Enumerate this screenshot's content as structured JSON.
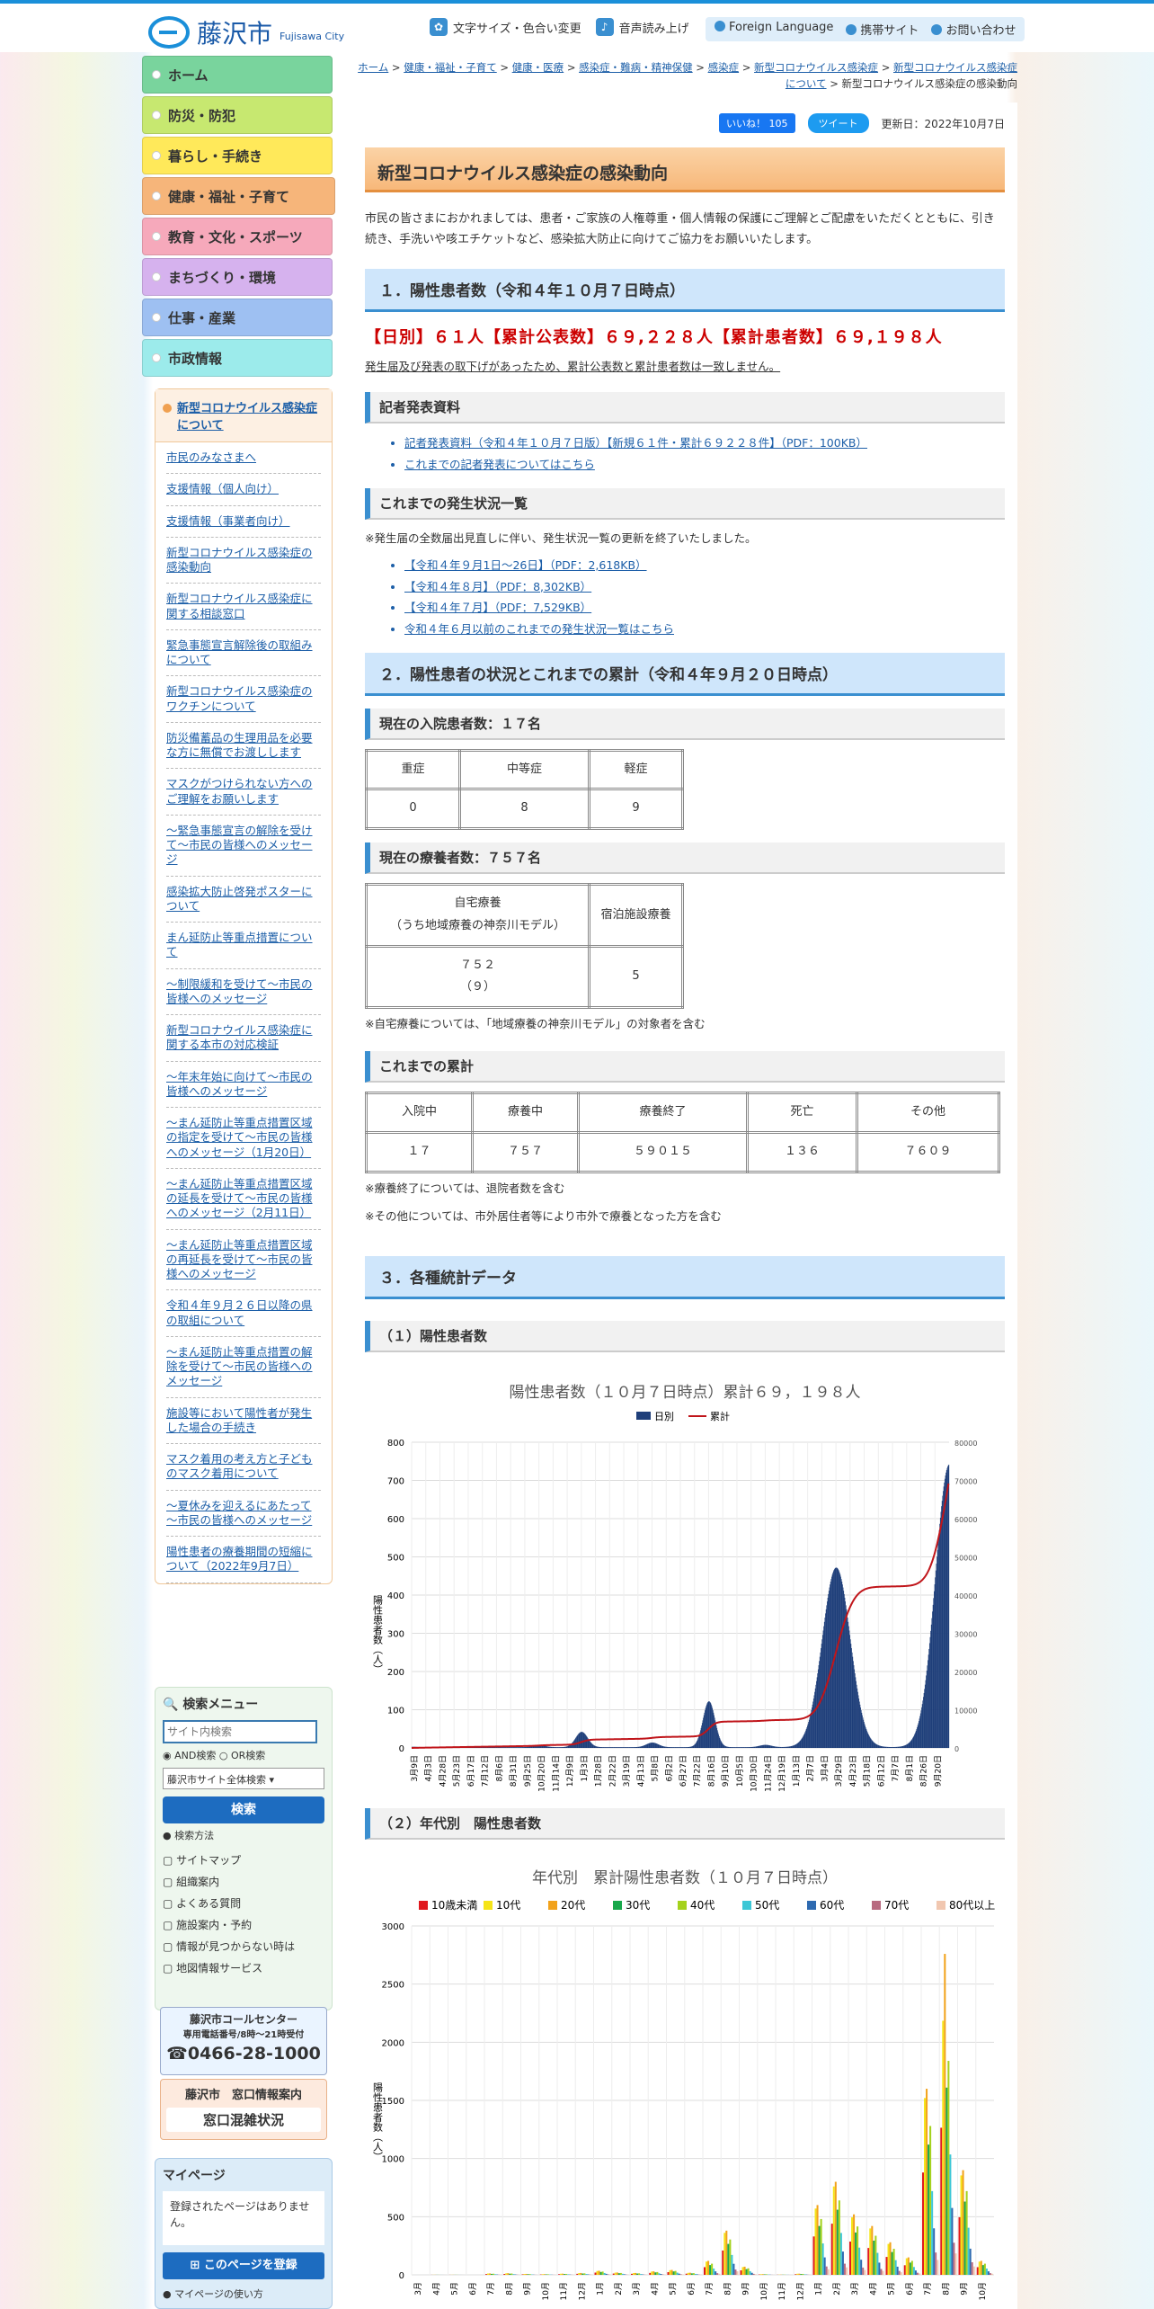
{
  "header": {
    "logo": "藤沢市",
    "logo_en": "Fujisawa City",
    "tools": [
      "文字サイズ・色合い変更",
      "音声読み上げ"
    ],
    "links": [
      "Foreign Language",
      "携帯サイト",
      "お問い合わせ"
    ]
  },
  "gnav": [
    {
      "label": "ホーム",
      "color": "#79d49d"
    },
    {
      "label": "防災・防犯",
      "color": "#c7e870"
    },
    {
      "label": "暮らし・手続き",
      "color": "#ffe95a"
    },
    {
      "label": "健康・福祉・子育て",
      "color": "#f6ac6a"
    },
    {
      "label": "教育・文化・スポーツ",
      "color": "#f6a9bb"
    },
    {
      "label": "まちづくり・環境",
      "color": "#d6b2ee"
    },
    {
      "label": "仕事・産業",
      "color": "#9ec0f2"
    },
    {
      "label": "市政情報",
      "color": "#9cebeb"
    }
  ],
  "side": {
    "head": "新型コロナウイルス感染症について",
    "items": [
      "市民のみなさまへ",
      "支援情報（個人向け）",
      "支援情報（事業者向け）",
      "新型コロナウイルス感染症の感染動向",
      "新型コロナウイルス感染症に関する相談窓口",
      "緊急事態宣言解除後の取組みについて",
      "新型コロナウイルス感染症のワクチンについて",
      "防災備蓄品の生理用品を必要な方に無償でお渡しします",
      "マスクがつけられない方へのご理解をお願いします",
      "～緊急事態宣言の解除を受けて～市民の皆様へのメッセージ",
      "感染拡大防止啓発ポスターについて",
      "まん延防止等重点措置について",
      "～制限緩和を受けて～市民の皆様へのメッセージ",
      "新型コロナウイルス感染症に関する本市の対応検証",
      "～年末年始に向けて～市民の皆様へのメッセージ",
      "～まん延防止等重点措置区域の指定を受けて～市民の皆様へのメッセージ（1月20日）",
      "～まん延防止等重点措置区域の延長を受けて～市民の皆様へのメッセージ（2月11日）",
      "～まん延防止等重点措置区域の再延長を受けて～市民の皆様へのメッセージ",
      "令和４年９月２６日以降の県の取組について",
      "～まん延防止等重点措置の解除を受けて～市民の皆様へのメッセージ",
      "施設等において陽性者が発生した場合の手続き",
      "マスク着用の考え方と子どものマスク着用について",
      "～夏休みを迎えるにあたって～市民の皆様へのメッセージ",
      "陽性患者の療養期間の短縮について（2022年9月7日）"
    ]
  },
  "search": {
    "title": "検索メニュー",
    "placeholder": "サイト内検索",
    "and": "AND検索",
    "or": "OR検索",
    "scope": "藤沢市サイト全体検索",
    "button": "検索",
    "how": "検索方法",
    "links": [
      "サイトマップ",
      "組織案内",
      "よくある質問",
      "施設案内・予約",
      "情報が見つからない時は",
      "地図情報サービス"
    ]
  },
  "call": {
    "l1": "藤沢市コールセンター",
    "l2": "専用電話番号/8時～21時受付",
    "tel": "0466-28-1000"
  },
  "mado": {
    "l1": "藤沢市　窓口情報案内",
    "l2": "窓口混雑状況"
  },
  "mypage": {
    "title": "マイページ",
    "text": "登録されたページはありません。",
    "btn": "このページを登録",
    "how": "マイページの使い方"
  },
  "breadcrumb": [
    "ホーム",
    "健康・福祉・子育て",
    "健康・医療",
    "感染症・難病・精神保健",
    "感染症",
    "新型コロナウイルス感染症",
    "新型コロナウイルス感染症について",
    "新型コロナウイルス感染症の感染動向"
  ],
  "meta": {
    "like": "いいね！ 105",
    "tweet": "ツイート",
    "updated": "更新日：2022年10月7日"
  },
  "title": "新型コロナウイルス感染症の感染動向",
  "intro": "市民の皆さまにおかれましては、患者・ご家族の人権尊重・個人情報の保護にご理解とご配慮をいただくとともに、引き続き、手洗いや咳エチケットなど、感染拡大防止に向けてご協力をお願いいたします。",
  "s1": {
    "h": "１．陽性患者数（令和４年１０月７日時点）",
    "big": "【日別】６１人【累計公表数】６９,２２８人【累計患者数】６９,１９８人",
    "note": "発生届及び発表の取下げがあったため、累計公表数と累計患者数は一致しません。",
    "press_h": "記者発表資料",
    "press": [
      "記者発表資料（令和４年１０月７日版）【新規６１件・累計６９２２８件】（PDF：100KB）",
      "これまでの記者発表についてはこちら"
    ],
    "hist_h": "これまでの発生状況一覧",
    "hist_note": "※発生届の全数届出見直しに伴い、発生状況一覧の更新を終了いたしました。",
    "hist": [
      "【令和４年９月1日～26日】（PDF：2,618KB）",
      "【令和４年８月】（PDF：8,302KB）",
      "【令和４年７月】（PDF：7,529KB）",
      "令和４年６月以前のこれまでの発生状況一覧はこちら"
    ]
  },
  "s2": {
    "h": "２．陽性患者の状況とこれまでの累計（令和４年９月２０日時点）",
    "hosp_h": "現在の入院患者数：１７名",
    "hosp_head": [
      "重症",
      "中等症",
      "軽症"
    ],
    "hosp_val": [
      "0",
      "8",
      "9"
    ],
    "home_h": "現在の療養者数：７５７名",
    "home_head1": "自宅療養",
    "home_head1b": "（うち地域療養の神奈川モデル）",
    "home_head2": "宿泊施設療養",
    "home_val1": "７５２",
    "home_val1b": "（９）",
    "home_val2": "5",
    "home_note": "※自宅療養については、「地域療養の神奈川モデル」の対象者を含む",
    "cum_h": "これまでの累計",
    "cum_head": [
      "入院中",
      "療養中",
      "療養終了",
      "死亡",
      "その他"
    ],
    "cum_val": [
      "１７",
      "７５７",
      "５９０１５",
      "１３６",
      "７６０９"
    ],
    "cum_note1": "※療養終了については、退院者数を含む",
    "cum_note2": "※その他については、市外居住者等により市外で療養となった方を含む"
  },
  "s3": {
    "h": "３．各種統計データ",
    "c1_h": "（１）陽性患者数",
    "c2_h": "（２）年代別　陽性患者数"
  },
  "chart_data": [
    {
      "type": "bar",
      "title": "陽性患者数（１０月７日時点）累計６９，１９８人",
      "series": [
        {
          "name": "日別"
        },
        {
          "name": "累計",
          "type": "line"
        }
      ],
      "ylabel": "陽性患者数（人）",
      "ylim": [
        0,
        800
      ],
      "y2lim": [
        0,
        80000
      ],
      "yticks": [
        "0",
        "100",
        "200",
        "300",
        "400",
        "500",
        "600",
        "700",
        "800"
      ],
      "y2ticks": [
        "0",
        "10000",
        "20000",
        "30000",
        "40000",
        "50000",
        "60000",
        "70000",
        "80000"
      ],
      "x": [
        "3月9日",
        "4月3日",
        "4月28日",
        "5月23日",
        "6月17日",
        "7月12日",
        "8月6日",
        "8月31日",
        "9月25日",
        "10月20日",
        "11月14日",
        "12月9日",
        "1月3日",
        "1月28日",
        "2月22日",
        "3月19日",
        "4月13日",
        "5月8日",
        "6月2日",
        "6月27日",
        "7月22日",
        "8月16日",
        "9月10日",
        "10月5日",
        "10月30日",
        "11月24日",
        "12月19日",
        "1月13日",
        "2月7日",
        "3月4日",
        "3月29日",
        "4月23日",
        "5月18日",
        "6月12日",
        "7月7日",
        "8月1日",
        "8月26日",
        "9月20日"
      ],
      "peaks_daily": [
        [
          0,
          1
        ],
        [
          9,
          5
        ],
        [
          12,
          40
        ],
        [
          17,
          12
        ],
        [
          21,
          120
        ],
        [
          25,
          6
        ],
        [
          30,
          470
        ],
        [
          38,
          740
        ]
      ],
      "cumulative_end": 69198,
      "colors": {
        "daily": "#1f3f7a",
        "cumulative": "#c0151a"
      }
    },
    {
      "type": "bar",
      "title": "年代別　累計陽性患者数（１０月７日時点）",
      "series": [
        {
          "name": "10歳未満",
          "color": "#e0181e"
        },
        {
          "name": "10代",
          "color": "#f5e418"
        },
        {
          "name": "20代",
          "color": "#f2a21a"
        },
        {
          "name": "30代",
          "color": "#18a84b"
        },
        {
          "name": "40代",
          "color": "#a4d21c"
        },
        {
          "name": "50代",
          "color": "#3cc7d6"
        },
        {
          "name": "60代",
          "color": "#2e6ab0"
        },
        {
          "name": "70代",
          "color": "#b86a80"
        },
        {
          "name": "80代以上",
          "color": "#f1c7b0"
        }
      ],
      "ylabel": "陽性患者数（人）",
      "ylim": [
        0,
        3000
      ],
      "yticks": [
        "0",
        "500",
        "1000",
        "1500",
        "2000",
        "2500",
        "3000"
      ],
      "x": [
        "3月",
        "4月",
        "5月",
        "6月",
        "7月",
        "8月",
        "9月",
        "10月",
        "11月",
        "12月",
        "1月",
        "2月",
        "3月",
        "4月",
        "5月",
        "6月",
        "7月",
        "8月",
        "9月",
        "10月",
        "11月",
        "12月",
        "1月",
        "2月",
        "3月",
        "4月",
        "5月",
        "6月",
        "7月",
        "8月",
        "9月",
        "10月"
      ],
      "totals_per_month_peak": [
        0,
        1,
        1,
        0,
        12,
        14,
        8,
        6,
        10,
        16,
        35,
        20,
        16,
        30,
        42,
        18,
        120,
        380,
        70,
        6,
        2,
        10,
        600,
        800,
        520,
        420,
        280,
        150,
        1600,
        2300,
        900,
        120
      ]
    }
  ]
}
